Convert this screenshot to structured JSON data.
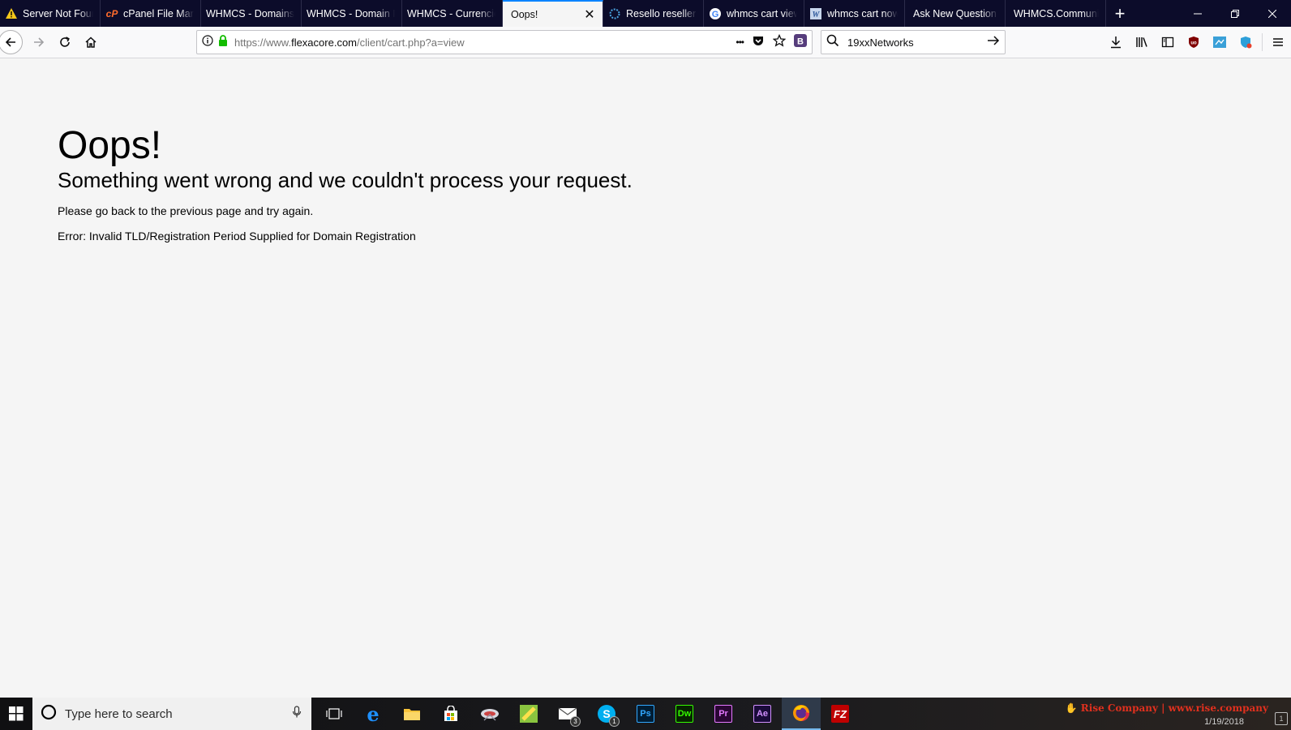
{
  "browser": {
    "tabs": [
      {
        "title": "Server Not Foun",
        "icon": "warning-icon"
      },
      {
        "title": "cPanel File Man",
        "icon": "cpanel-icon"
      },
      {
        "title": "WHMCS - Domains/",
        "icon": "none"
      },
      {
        "title": "WHMCS - Domain R",
        "icon": "none"
      },
      {
        "title": "WHMCS - Currencie",
        "icon": "none"
      },
      {
        "title": "Oops!",
        "icon": "none",
        "active": true
      },
      {
        "title": "Resello reseller a",
        "icon": "resello-icon"
      },
      {
        "title": "whmcs cart view",
        "icon": "google-icon"
      },
      {
        "title": "whmcs cart now",
        "icon": "word-icon"
      },
      {
        "title": "Ask New Question -",
        "icon": "none"
      },
      {
        "title": "WHMCS.Communit",
        "icon": "none"
      }
    ],
    "new_tab_label": "+",
    "url": {
      "prefix": "https://www.",
      "host": "flexacore.com",
      "path": "/client/cart.php?a=view"
    },
    "url_actions_more": "•••",
    "search_value": "19xxNetworks",
    "accent_color": "#0a84ff",
    "tabstrip_color": "#0c0c2a"
  },
  "page": {
    "title": "Oops!",
    "subtitle": "Something went wrong and we couldn't process your request.",
    "message": "Please go back to the previous page and try again.",
    "error": "Error: Invalid TLD/Registration Period Supplied for Domain Registration"
  },
  "taskbar": {
    "search_placeholder": "Type here to search",
    "apps": [
      {
        "name": "task-view",
        "label": ""
      },
      {
        "name": "edge",
        "label": "e"
      },
      {
        "name": "file-explorer",
        "label": ""
      },
      {
        "name": "store",
        "label": ""
      },
      {
        "name": "app-5",
        "label": ""
      },
      {
        "name": "app-6",
        "label": ""
      },
      {
        "name": "mail",
        "label": "",
        "badge": "3"
      },
      {
        "name": "skype",
        "label": "S",
        "badge": "1"
      },
      {
        "name": "photoshop",
        "label": "Ps"
      },
      {
        "name": "dreamweaver",
        "label": "Dw"
      },
      {
        "name": "premiere",
        "label": "Pr"
      },
      {
        "name": "after-effects",
        "label": "Ae"
      },
      {
        "name": "firefox",
        "label": "",
        "active": true
      },
      {
        "name": "filezilla",
        "label": "FZ"
      }
    ],
    "tray_banner": "Rise Company | www.rise.company",
    "date": "1/19/2018"
  }
}
